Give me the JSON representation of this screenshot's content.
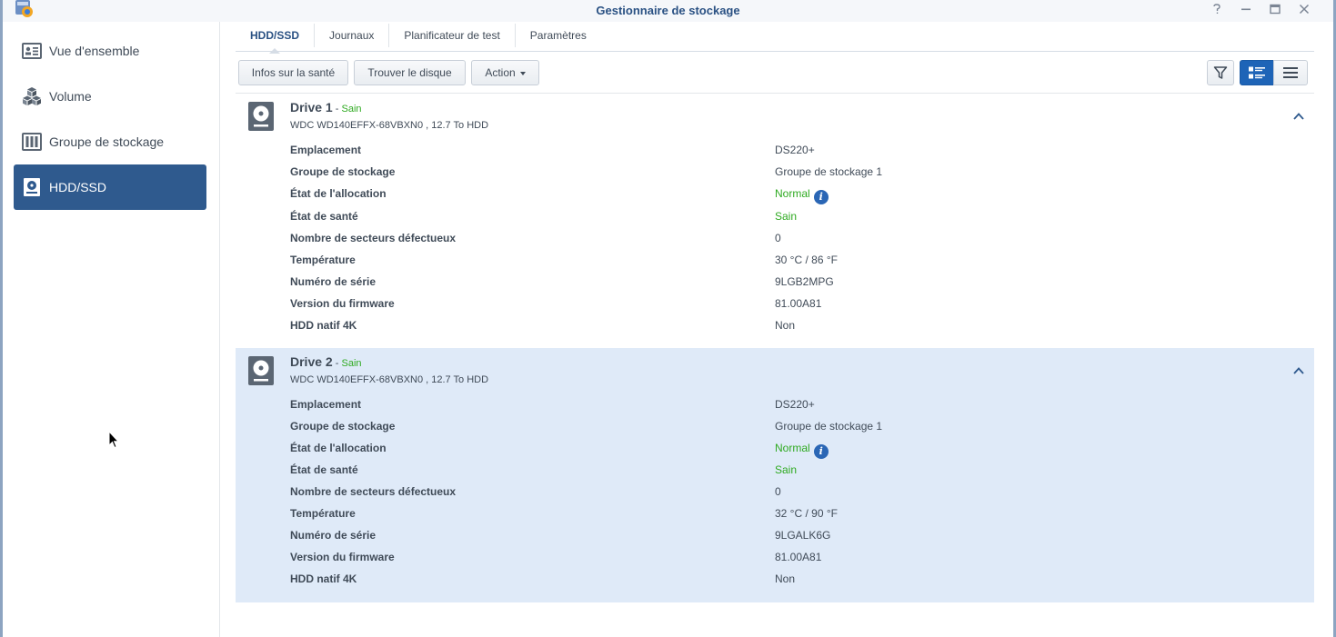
{
  "window": {
    "title": "Gestionnaire de stockage",
    "controls": {
      "help": "?",
      "minimize": "—",
      "maximize": "□",
      "close": "✕"
    }
  },
  "sidebar": {
    "items": [
      {
        "label": "Vue d'ensemble",
        "icon": "overview-icon",
        "active": false
      },
      {
        "label": "Volume",
        "icon": "volume-cubes-icon",
        "active": false
      },
      {
        "label": "Groupe de stockage",
        "icon": "storage-pool-icon",
        "active": false
      },
      {
        "label": "HDD/SSD",
        "icon": "hdd-icon",
        "active": true
      }
    ]
  },
  "tabs": [
    {
      "label": "HDD/SSD",
      "active": true
    },
    {
      "label": "Journaux",
      "active": false
    },
    {
      "label": "Planificateur de test",
      "active": false
    },
    {
      "label": "Paramètres",
      "active": false
    }
  ],
  "toolbar": {
    "health_info": "Infos sur la santé",
    "locate_disk": "Trouver le disque",
    "action": "Action",
    "filter_icon": "filter-icon",
    "detail_view_icon": "detail-list-icon",
    "list_view_icon": "list-icon"
  },
  "drives": [
    {
      "name": "Drive 1",
      "separator": " - ",
      "status": "Sain",
      "model": "WDC WD140EFFX-68VBXN0 , 12.7 To HDD",
      "highlighted": false,
      "details": [
        {
          "label": "Emplacement",
          "value": "DS220+",
          "green": false,
          "info": false
        },
        {
          "label": "Groupe de stockage",
          "value": "Groupe de stockage 1",
          "green": false,
          "info": false
        },
        {
          "label": "État de l'allocation",
          "value": "Normal",
          "green": true,
          "info": true
        },
        {
          "label": "État de santé",
          "value": "Sain",
          "green": true,
          "info": false
        },
        {
          "label": "Nombre de secteurs défectueux",
          "value": "0",
          "green": false,
          "info": false
        },
        {
          "label": "Température",
          "value": "30 °C / 86 °F",
          "green": false,
          "info": false
        },
        {
          "label": "Numéro de série",
          "value": "9LGB2MPG",
          "green": false,
          "info": false
        },
        {
          "label": "Version du firmware",
          "value": "81.00A81",
          "green": false,
          "info": false
        },
        {
          "label": "HDD natif 4K",
          "value": "Non",
          "green": false,
          "info": false
        }
      ]
    },
    {
      "name": "Drive 2",
      "separator": " - ",
      "status": "Sain",
      "model": "WDC WD140EFFX-68VBXN0 , 12.7 To HDD",
      "highlighted": true,
      "details": [
        {
          "label": "Emplacement",
          "value": "DS220+",
          "green": false,
          "info": false
        },
        {
          "label": "Groupe de stockage",
          "value": "Groupe de stockage 1",
          "green": false,
          "info": false
        },
        {
          "label": "État de l'allocation",
          "value": "Normal",
          "green": true,
          "info": true
        },
        {
          "label": "État de santé",
          "value": "Sain",
          "green": true,
          "info": false
        },
        {
          "label": "Nombre de secteurs défectueux",
          "value": "0",
          "green": false,
          "info": false
        },
        {
          "label": "Température",
          "value": "32 °C / 90 °F",
          "green": false,
          "info": false
        },
        {
          "label": "Numéro de série",
          "value": "9LGALK6G",
          "green": false,
          "info": false
        },
        {
          "label": "Version du firmware",
          "value": "81.00A81",
          "green": false,
          "info": false
        },
        {
          "label": "HDD natif 4K",
          "value": "Non",
          "green": false,
          "info": false
        }
      ]
    }
  ],
  "info_icon_glyph": "i",
  "colors": {
    "accent": "#2f5a8e",
    "title": "#2a5183",
    "healthy": "#2faa21",
    "highlight_row": "#dfeaf8",
    "selected_view": "#1e64b7"
  }
}
